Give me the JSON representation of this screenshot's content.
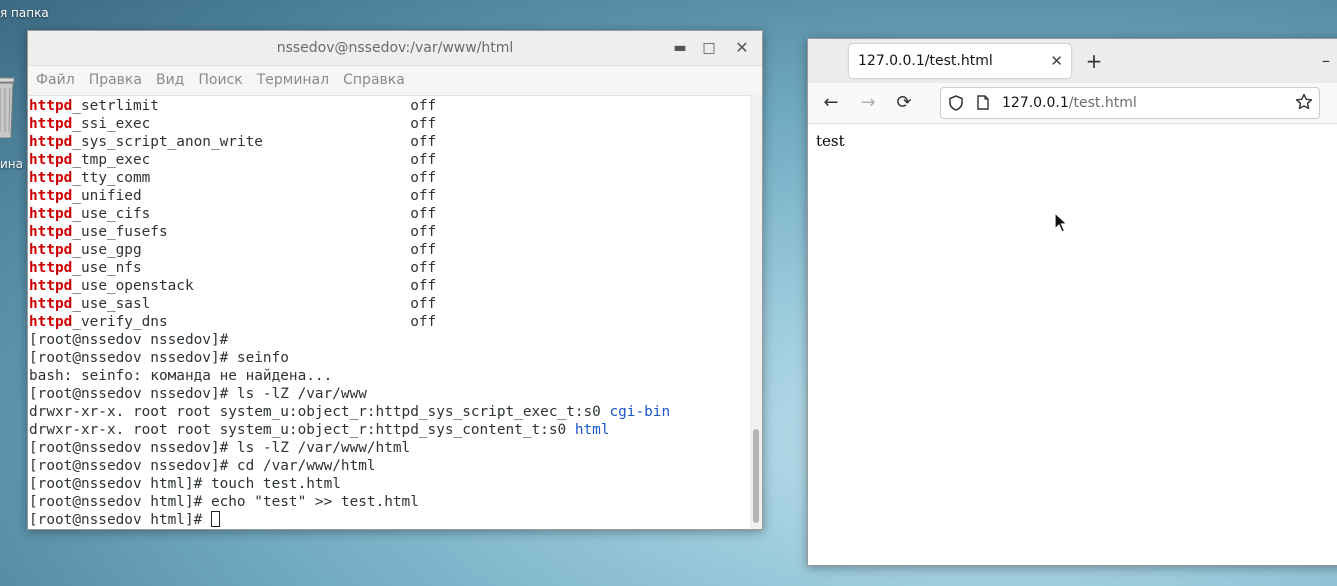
{
  "desktop": {
    "folder_label": "я папка",
    "trash_label": "ина"
  },
  "terminal": {
    "title": "nssedov@nssedov:/var/www/html",
    "menu": [
      "Файл",
      "Правка",
      "Вид",
      "Поиск",
      "Терминал",
      "Справка"
    ],
    "booleans": [
      {
        "kw": "httpd",
        "rest": "_setrlimit",
        "value": "off"
      },
      {
        "kw": "httpd",
        "rest": "_ssi_exec",
        "value": "off"
      },
      {
        "kw": "httpd",
        "rest": "_sys_script_anon_write",
        "value": "off"
      },
      {
        "kw": "httpd",
        "rest": "_tmp_exec",
        "value": "off"
      },
      {
        "kw": "httpd",
        "rest": "_tty_comm",
        "value": "off"
      },
      {
        "kw": "httpd",
        "rest": "_unified",
        "value": "off"
      },
      {
        "kw": "httpd",
        "rest": "_use_cifs",
        "value": "off"
      },
      {
        "kw": "httpd",
        "rest": "_use_fusefs",
        "value": "off"
      },
      {
        "kw": "httpd",
        "rest": "_use_gpg",
        "value": "off"
      },
      {
        "kw": "httpd",
        "rest": "_use_nfs",
        "value": "off"
      },
      {
        "kw": "httpd",
        "rest": "_use_openstack",
        "value": "off"
      },
      {
        "kw": "httpd",
        "rest": "_use_sasl",
        "value": "off"
      },
      {
        "kw": "httpd",
        "rest": "_verify_dns",
        "value": "off"
      }
    ],
    "lines": [
      {
        "text": "[root@nssedov nssedov]#"
      },
      {
        "text": "[root@nssedov nssedov]# seinfo"
      },
      {
        "text": "bash: seinfo: команда не найдена..."
      },
      {
        "text": "[root@nssedov nssedov]# ls -lZ /var/www"
      },
      {
        "text": "drwxr-xr-x. root root system_u:object_r:httpd_sys_script_exec_t:s0 ",
        "dir": "cgi-bin"
      },
      {
        "text": "drwxr-xr-x. root root system_u:object_r:httpd_sys_content_t:s0 ",
        "dir": "html"
      },
      {
        "text": "[root@nssedov nssedov]# ls -lZ /var/www/html"
      },
      {
        "text": "[root@nssedov nssedov]# cd /var/www/html"
      },
      {
        "text": "[root@nssedov html]# touch test.html"
      },
      {
        "text": "[root@nssedov html]# echo \"test\" >> test.html"
      }
    ],
    "prompt": "[root@nssedov html]# "
  },
  "browser": {
    "tab_title": "127.0.0.1/test.html",
    "url_host": "127.0.0.1",
    "url_path": "/test.html",
    "page_text": "test"
  }
}
